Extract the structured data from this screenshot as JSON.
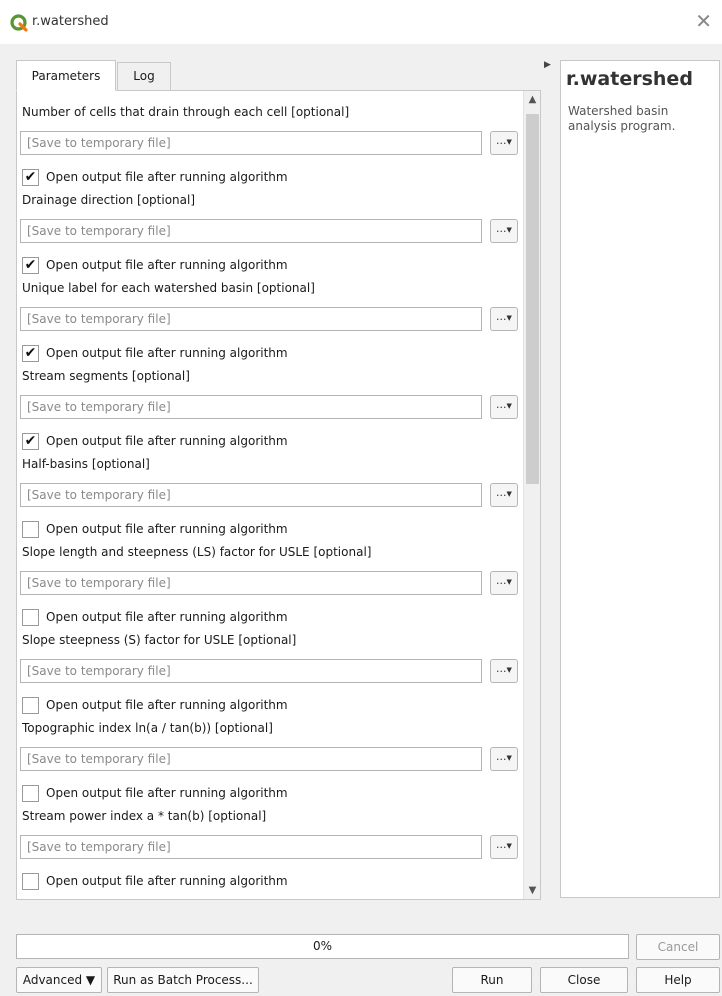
{
  "window": {
    "title": "r.watershed",
    "close_glyph": "✕",
    "app_icon": "qgis-logo"
  },
  "tabs": [
    {
      "label": "Parameters",
      "active": true
    },
    {
      "label": "Log",
      "active": false
    }
  ],
  "outputs": [
    {
      "label": "Number of cells that drain through each cell [optional]",
      "value": "",
      "placeholder": "[Save to temporary file]",
      "open_after": true
    },
    {
      "label": "Drainage direction [optional]",
      "value": "",
      "placeholder": "[Save to temporary file]",
      "open_after": true
    },
    {
      "label": "Unique label for each watershed basin [optional]",
      "value": "",
      "placeholder": "[Save to temporary file]",
      "open_after": true
    },
    {
      "label": "Stream segments [optional]",
      "value": "",
      "placeholder": "[Save to temporary file]",
      "open_after": true
    },
    {
      "label": "Half-basins [optional]",
      "value": "",
      "placeholder": "[Save to temporary file]",
      "open_after": false
    },
    {
      "label": "Slope length and steepness (LS) factor for USLE [optional]",
      "value": "",
      "placeholder": "[Save to temporary file]",
      "open_after": false
    },
    {
      "label": "Slope steepness (S) factor for USLE [optional]",
      "value": "",
      "placeholder": "[Save to temporary file]",
      "open_after": false
    },
    {
      "label": "Topographic index ln(a / tan(b)) [optional]",
      "value": "",
      "placeholder": "[Save to temporary file]",
      "open_after": false
    },
    {
      "label": "Stream power index a * tan(b) [optional]",
      "value": "",
      "placeholder": "[Save to temporary file]",
      "open_after": false
    }
  ],
  "open_after_label": "Open output file after running algorithm",
  "browse_label": "...",
  "checkmark_glyph": "✔",
  "help": {
    "title": "r.watershed",
    "description": "Watershed basin analysis program."
  },
  "progress": {
    "value": 0,
    "text": "0%"
  },
  "buttons": {
    "cancel": "Cancel",
    "advanced": "Advanced ▼",
    "batch": "Run as Batch Process...",
    "run": "Run",
    "close": "Close",
    "help": "Help"
  },
  "colors": {
    "accent": "#2e86de",
    "qgis_green": "#589632",
    "qgis_yellow": "#ee7913"
  }
}
